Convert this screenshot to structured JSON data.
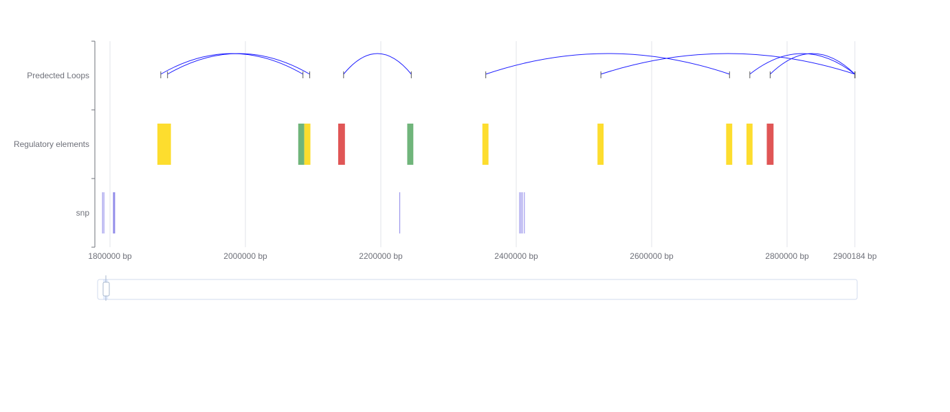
{
  "chart_data": {
    "type": "genome-track",
    "tracks": [
      "Predected Loops",
      "Regulatory elements",
      "snp"
    ],
    "x_unit": "bp",
    "xlim": [
      1800000,
      2900184
    ],
    "x_ticks": [
      1800000,
      2000000,
      2200000,
      2400000,
      2600000,
      2800000,
      2900184
    ],
    "x_tick_labels": [
      "1800000 bp",
      "2000000 bp",
      "2200000 bp",
      "2400000 bp",
      "2600000 bp",
      "2800000 bp",
      "2900184 bp"
    ],
    "grid": true,
    "loops": [
      {
        "start": 1875000,
        "end": 2085000
      },
      {
        "start": 1885000,
        "end": 2095000
      },
      {
        "start": 2145000,
        "end": 2245000
      },
      {
        "start": 2355000,
        "end": 2715000
      },
      {
        "start": 2525000,
        "end": 2900184
      },
      {
        "start": 2745000,
        "end": 2900184
      },
      {
        "start": 2775000,
        "end": 2900184
      }
    ],
    "regulatory_elements": [
      {
        "start": 1870000,
        "end": 1890000,
        "type": "yellow"
      },
      {
        "start": 2078000,
        "end": 2087000,
        "type": "green"
      },
      {
        "start": 2087000,
        "end": 2096000,
        "type": "yellow"
      },
      {
        "start": 2137000,
        "end": 2147000,
        "type": "red"
      },
      {
        "start": 2239000,
        "end": 2248000,
        "type": "green"
      },
      {
        "start": 2350000,
        "end": 2359000,
        "type": "yellow"
      },
      {
        "start": 2520000,
        "end": 2529000,
        "type": "yellow"
      },
      {
        "start": 2710000,
        "end": 2719000,
        "type": "yellow"
      },
      {
        "start": 2740000,
        "end": 2749000,
        "type": "yellow"
      },
      {
        "start": 2770000,
        "end": 2780000,
        "type": "red"
      }
    ],
    "element_colors": {
      "yellow": "#fddd2e",
      "green": "#70b57b",
      "red": "#e05656"
    },
    "loop_color": "#1a1aff",
    "snps": [
      1789000,
      1791000,
      1805000,
      1806000,
      1807000,
      2228000,
      2405000,
      2407000,
      2409000,
      2412000
    ],
    "snp_color": "#8b85e8",
    "zoom_window": [
      0,
      0.012
    ]
  }
}
